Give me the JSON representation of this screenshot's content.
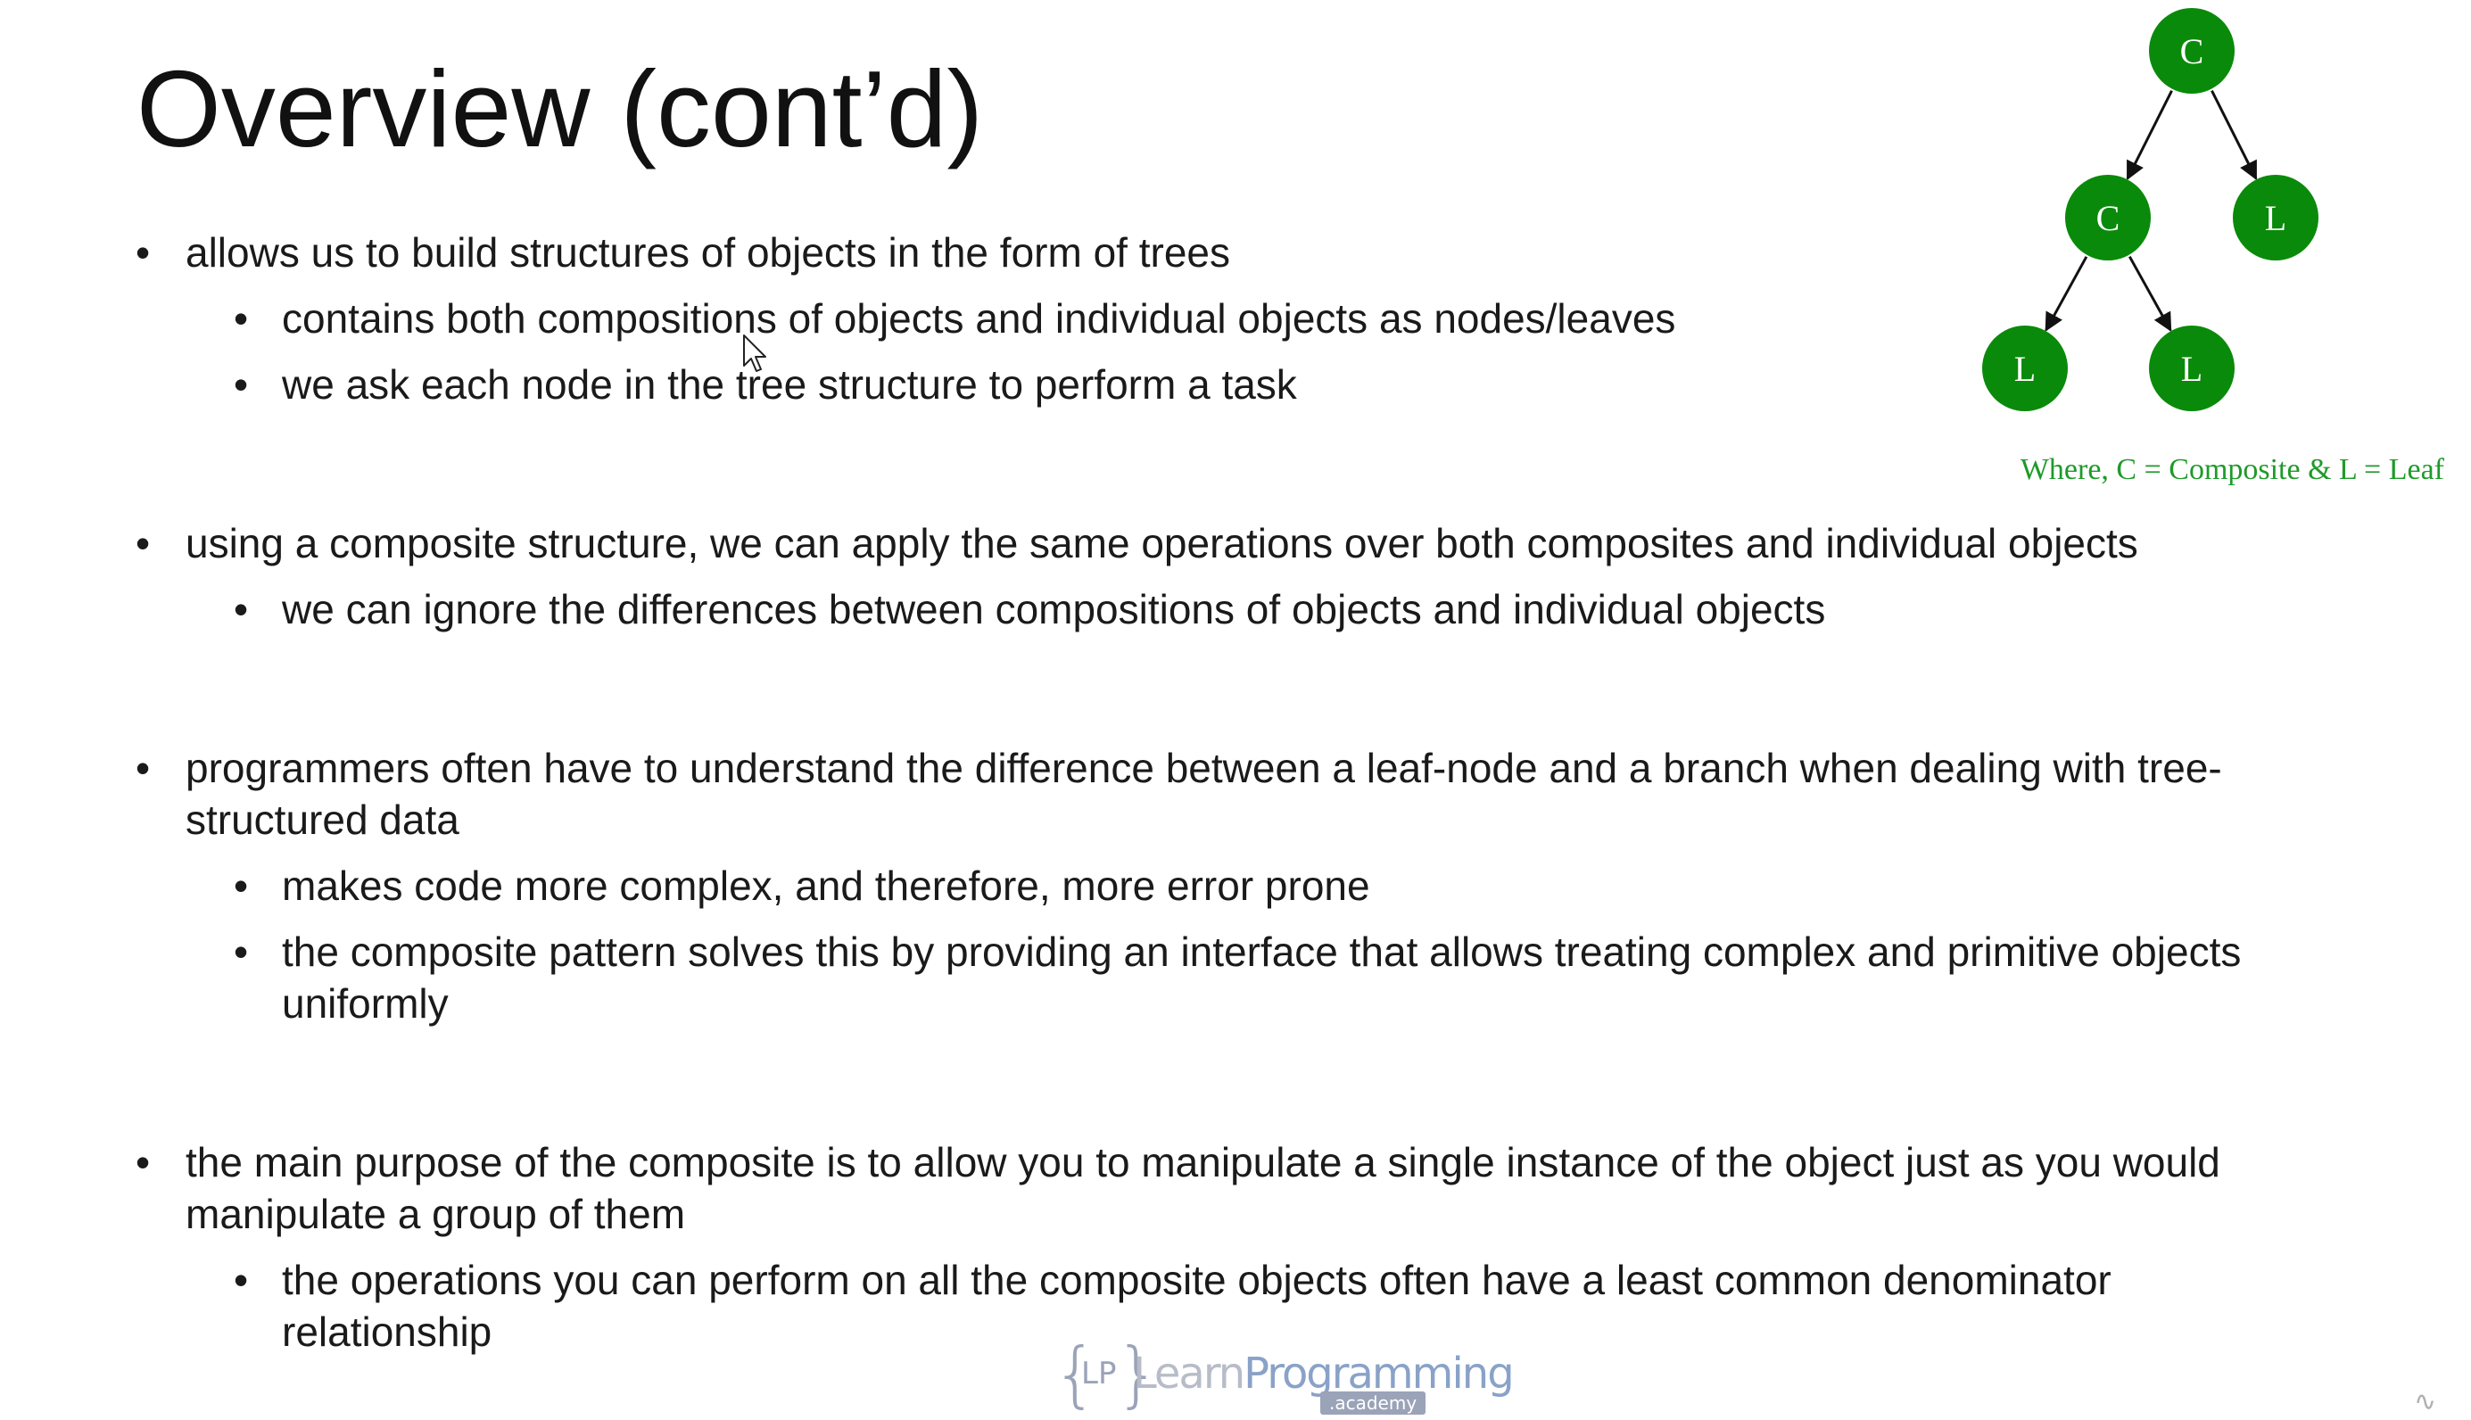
{
  "slide": {
    "title": "Overview (cont’d)",
    "bullets": [
      {
        "text": "allows us to build structures of objects in the form of trees",
        "children": [
          "contains both compositions of objects and individual objects as nodes/leaves",
          "we ask each node in the tree structure to perform a task"
        ]
      },
      {
        "text": "using a composite structure, we can apply the same operations over both composites and individual objects",
        "children": [
          "we can ignore the differences between compositions of objects and individual objects"
        ]
      },
      {
        "text": "programmers often have to understand the difference between a leaf-node and a branch when dealing with tree-structured data",
        "children": [
          "makes code more complex, and therefore, more error prone",
          "the composite pattern solves this by providing an interface that allows treating complex and primitive objects uniformly"
        ]
      },
      {
        "text": "the main purpose of the composite is to allow you to manipulate a single instance of the object just as you would manipulate a group of them",
        "children": [
          "the operations you can perform on all the composite objects often have a least common denominator relationship"
        ]
      }
    ],
    "bullet_symbol": "•"
  },
  "diagram": {
    "nodes": [
      {
        "id": "root",
        "label": "C"
      },
      {
        "id": "mid",
        "label": "C"
      },
      {
        "id": "right",
        "label": "L"
      },
      {
        "id": "ll",
        "label": "L"
      },
      {
        "id": "lr",
        "label": "L"
      }
    ],
    "edges": [
      [
        "root",
        "mid"
      ],
      [
        "root",
        "right"
      ],
      [
        "mid",
        "ll"
      ],
      [
        "mid",
        "lr"
      ]
    ],
    "caption": "Where, C = Composite & L = Leaf",
    "node_color": "#0a8a0a",
    "caption_color": "#1f9a2a"
  },
  "logo": {
    "brace_left": "{",
    "initials": "LP",
    "brace_right": "}",
    "word_learn": "Learn",
    "word_programming": "Programming",
    "badge": ".academy"
  },
  "icons": {
    "cursor": "mouse-pointer-icon"
  }
}
